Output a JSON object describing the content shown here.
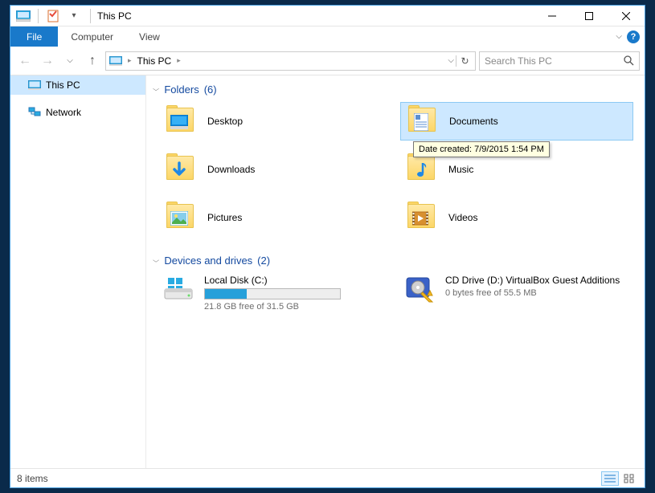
{
  "window": {
    "title": "This PC"
  },
  "ribbon": {
    "file": "File",
    "tabs": [
      "Computer",
      "View"
    ]
  },
  "address": {
    "location": "This PC",
    "search_placeholder": "Search This PC"
  },
  "nav": {
    "items": [
      {
        "label": "This PC",
        "icon": "monitor",
        "selected": true
      },
      {
        "label": "Network",
        "icon": "network",
        "selected": false
      }
    ]
  },
  "sections": {
    "folders": {
      "title": "Folders",
      "count_suffix": "(6)"
    },
    "drives": {
      "title": "Devices and drives",
      "count_suffix": "(2)"
    }
  },
  "folders": [
    {
      "label": "Desktop",
      "overlay": "desktop"
    },
    {
      "label": "Documents",
      "overlay": "documents",
      "selected": true
    },
    {
      "label": "Downloads",
      "overlay": "downloads"
    },
    {
      "label": "Music",
      "overlay": "music"
    },
    {
      "label": "Pictures",
      "overlay": "pictures"
    },
    {
      "label": "Videos",
      "overlay": "videos"
    }
  ],
  "tooltip": {
    "text": "Date created: 7/9/2015 1:54 PM"
  },
  "drives": [
    {
      "label": "Local Disk (C:)",
      "sub": "21.8 GB free of 31.5 GB",
      "fill_pct": 31,
      "type": "hdd"
    },
    {
      "label": "CD Drive (D:) VirtualBox Guest Additions",
      "sub": "0 bytes free of 55.5 MB",
      "type": "cd"
    }
  ],
  "statusbar": {
    "items": "8 items"
  }
}
